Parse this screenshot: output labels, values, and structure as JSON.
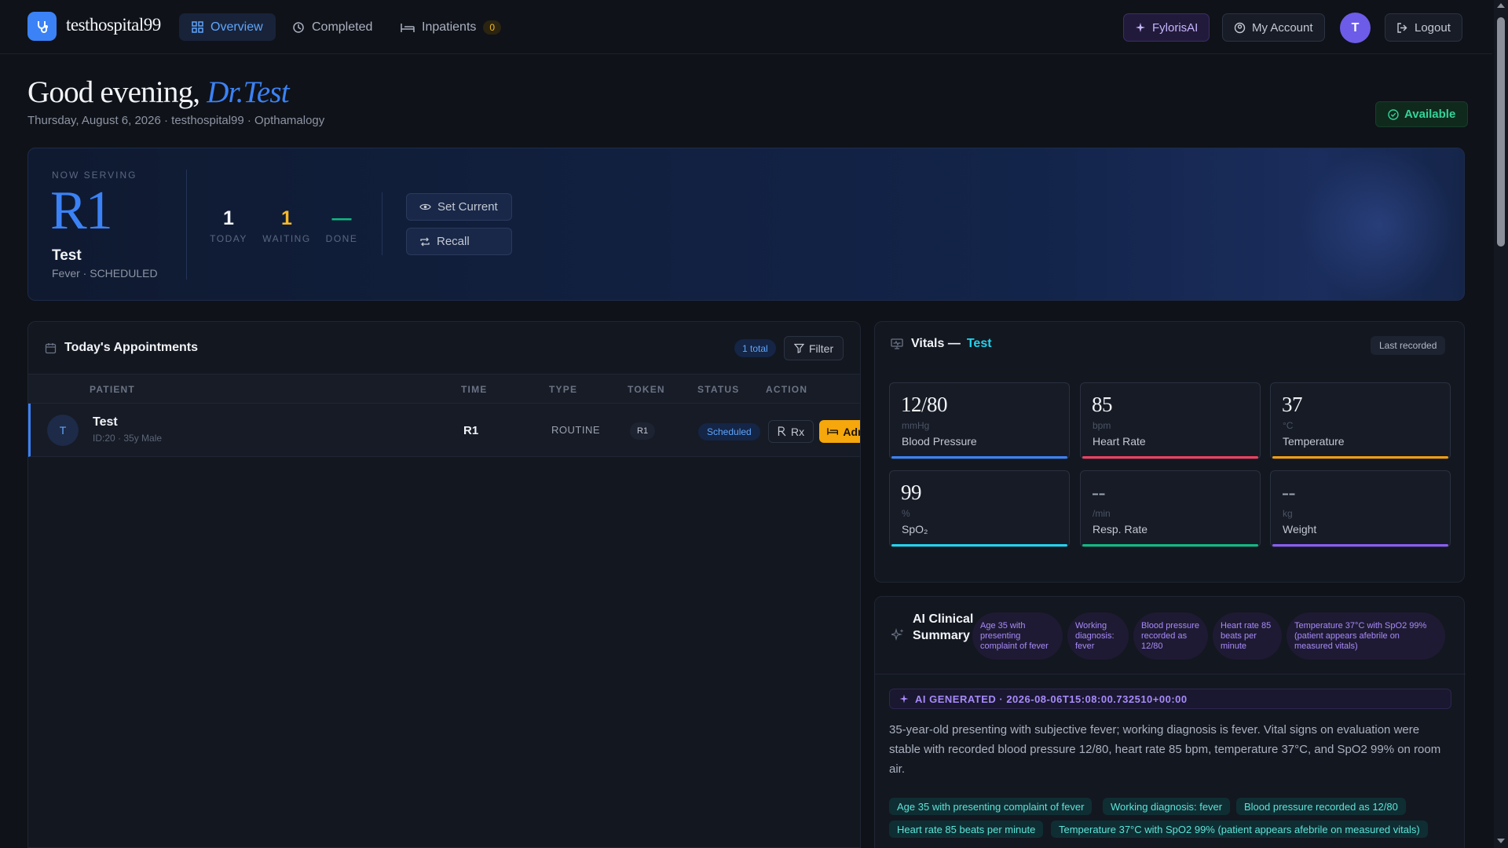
{
  "nav": {
    "brand": "testhospital99",
    "items": [
      {
        "label": "Overview"
      },
      {
        "label": "Completed"
      },
      {
        "label": "Inpatients",
        "count": "0"
      }
    ],
    "ai_label": "FylorisAI",
    "account_label": "My Account",
    "avatar_initial": "T",
    "logout_label": "Logout"
  },
  "greeting": {
    "prefix": "Good evening,",
    "doctor": "Dr.Test",
    "subline": "Thursday, August 6, 2026 · testhospital99 · Opthamalogy",
    "status": "Available"
  },
  "now_serving": {
    "label": "NOW SERVING",
    "token": "R1",
    "name": "Test",
    "sub": "Fever · SCHEDULED",
    "stats": [
      {
        "num": "1",
        "label": "TODAY"
      },
      {
        "num": "1",
        "label": "WAITING"
      },
      {
        "num": "—",
        "label": "DONE"
      }
    ],
    "set_current_label": "Set Current",
    "recall_label": "Recall"
  },
  "appointments": {
    "title": "Today's Appointments",
    "total": "1 total",
    "filter_label": "Filter",
    "columns": [
      "PATIENT",
      "TIME",
      "TYPE",
      "TOKEN",
      "STATUS",
      "ACTION"
    ],
    "rows": [
      {
        "initial": "T",
        "name": "Test",
        "meta": "ID:20 · 35y Male",
        "time": "R1",
        "type": "ROUTINE",
        "token": "R1",
        "status": "Scheduled",
        "rx_label": "Rx",
        "admit_label": "Admit"
      }
    ]
  },
  "vitals": {
    "title": "Vitals —",
    "patient": "Test",
    "last_recorded": "Last recorded",
    "cards": [
      {
        "value": "12/80",
        "unit": "mmHg",
        "name": "Blood Pressure",
        "color": "#3b82f6"
      },
      {
        "value": "85",
        "unit": "bpm",
        "name": "Heart Rate",
        "color": "#f43f5e"
      },
      {
        "value": "37",
        "unit": "°C",
        "name": "Temperature",
        "color": "#f59e0b"
      },
      {
        "value": "99",
        "unit": "%",
        "name": "SpO₂",
        "color": "#22d3ee"
      },
      {
        "value": "--",
        "unit": "/min",
        "name": "Resp. Rate",
        "color": "#10b981"
      },
      {
        "value": "--",
        "unit": "kg",
        "name": "Weight",
        "color": "#8b5cf6"
      }
    ]
  },
  "ai_summary": {
    "title": "AI Clinical Summary",
    "chips": [
      "Age 35 with presenting complaint of fever",
      "Working diagnosis: fever",
      "Blood pressure recorded as 12/80",
      "Heart rate 85 beats per minute",
      "Temperature 37°C with SpO2 99% (patient appears afebrile on measured vitals)"
    ],
    "generated": "AI GENERATED · 2026-08-06T15:08:00.732510+00:00",
    "body": "35-year-old presenting with subjective fever; working diagnosis is fever. Vital signs on evaluation were stable with recorded blood pressure 12/80, heart rate 85 bpm, temperature 37°C, and SpO2 99% on room air.",
    "tags": [
      "Age 35 with presenting complaint of fever",
      "Working diagnosis: fever",
      "Blood pressure recorded as 12/80",
      "Heart rate 85 beats per minute",
      "Temperature 37°C with SpO2 99% (patient appears afebrile on measured vitals)"
    ]
  }
}
